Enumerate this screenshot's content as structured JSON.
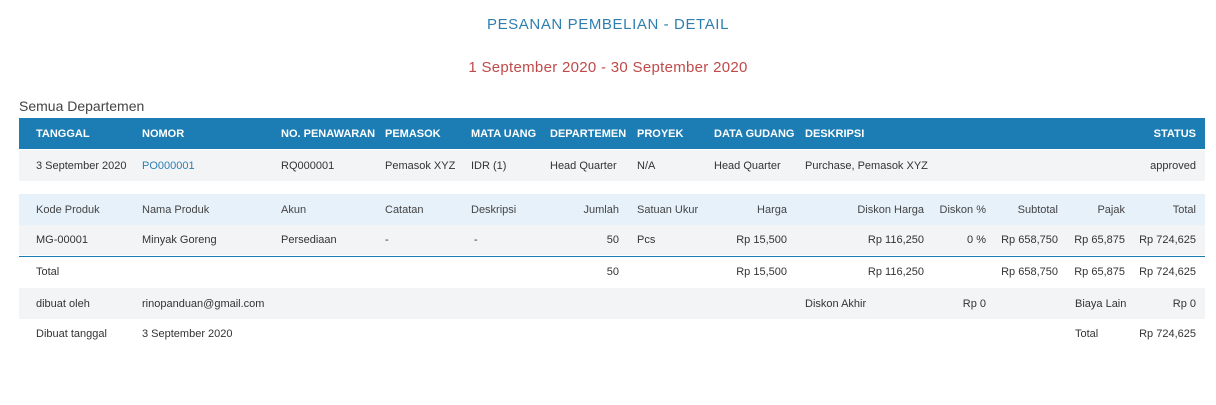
{
  "report": {
    "title": "PESANAN PEMBELIAN - DETAIL",
    "period": "1 September 2020 - 30 September 2020",
    "department_label": "Semua Departemen"
  },
  "header": {
    "tanggal": "TANGGAL",
    "nomor": "NOMOR",
    "no_penawaran": "NO. PENAWARAN",
    "pemasok": "PEMASOK",
    "mata_uang": "MATA UANG",
    "departemen": "DEPARTEMEN",
    "proyek": "PROYEK",
    "data_gudang": "DATA GUDANG",
    "deskripsi": "DESKRIPSI",
    "status": "STATUS"
  },
  "order": {
    "tanggal": "3 September 2020",
    "nomor": "PO000001",
    "no_penawaran": "RQ000001",
    "pemasok": "Pemasok XYZ",
    "mata_uang": "IDR  (1)",
    "departemen": "Head Quarter",
    "proyek": "N/A",
    "data_gudang": "Head Quarter",
    "deskripsi": "Purchase, Pemasok XYZ",
    "status": "approved"
  },
  "item_header": {
    "kode_produk": "Kode Produk",
    "nama_produk": "Nama Produk",
    "akun": "Akun",
    "catatan": "Catatan",
    "deskripsi": "Deskripsi",
    "jumlah": "Jumlah",
    "satuan_ukur": "Satuan Ukur",
    "harga": "Harga",
    "diskon_harga": "Diskon Harga",
    "diskon_pct": "Diskon %",
    "subtotal": "Subtotal",
    "pajak": "Pajak",
    "total": "Total"
  },
  "item": {
    "kode_produk": "MG-00001",
    "nama_produk": "Minyak Goreng",
    "akun": "Persediaan",
    "catatan": "-",
    "deskripsi": "-",
    "jumlah": "50",
    "satuan_ukur": "Pcs",
    "harga": "Rp 15,500",
    "diskon_harga": "Rp 116,250",
    "diskon_pct": "0 %",
    "subtotal": "Rp 658,750",
    "pajak": "Rp 65,875",
    "total": "Rp 724,625"
  },
  "totals": {
    "label": "Total",
    "jumlah": "50",
    "harga": "Rp 15,500",
    "diskon_harga": "Rp 116,250",
    "subtotal": "Rp 658,750",
    "pajak": "Rp 65,875",
    "total": "Rp 724,625"
  },
  "footer": {
    "dibuat_oleh_label": "dibuat oleh",
    "dibuat_oleh": "rinopanduan@gmail.com",
    "diskon_akhir_label": "Diskon Akhir",
    "diskon_akhir": "Rp 0",
    "biaya_lain_label": "Biaya Lain",
    "biaya_lain": "Rp 0",
    "dibuat_tanggal_label": "Dibuat tanggal",
    "dibuat_tanggal": "3 September 2020",
    "total_label": "Total",
    "total": "Rp 724,625"
  }
}
